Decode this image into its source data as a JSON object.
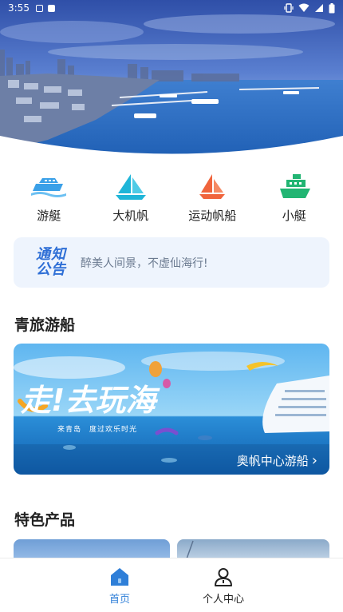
{
  "status_bar": {
    "time": "3:55"
  },
  "categories": [
    {
      "label": "游艇",
      "icon": "yacht-icon",
      "color": "#3aa0e8"
    },
    {
      "label": "大机帆",
      "icon": "sailboat-icon",
      "color": "#1fb5d8"
    },
    {
      "label": "运动帆船",
      "icon": "sport-sailboat-icon",
      "color": "#f0643c"
    },
    {
      "label": "小艇",
      "icon": "small-boat-icon",
      "color": "#22b573"
    }
  ],
  "notice": {
    "badge_line1": "通知",
    "badge_line2": "公告",
    "text": "醉美人间景，不虚仙海行!"
  },
  "sections": {
    "cruise_title": "青旅游船",
    "featured_title": "特色产品"
  },
  "banner": {
    "slogan": "走!去玩海",
    "subtitle": "来青岛　度过欢乐时光",
    "caption": "奥帆中心游船",
    "caption_arrow": "›"
  },
  "bottom_nav": {
    "home_label": "首页",
    "profile_label": "个人中心",
    "active_color": "#2f7fd8"
  }
}
